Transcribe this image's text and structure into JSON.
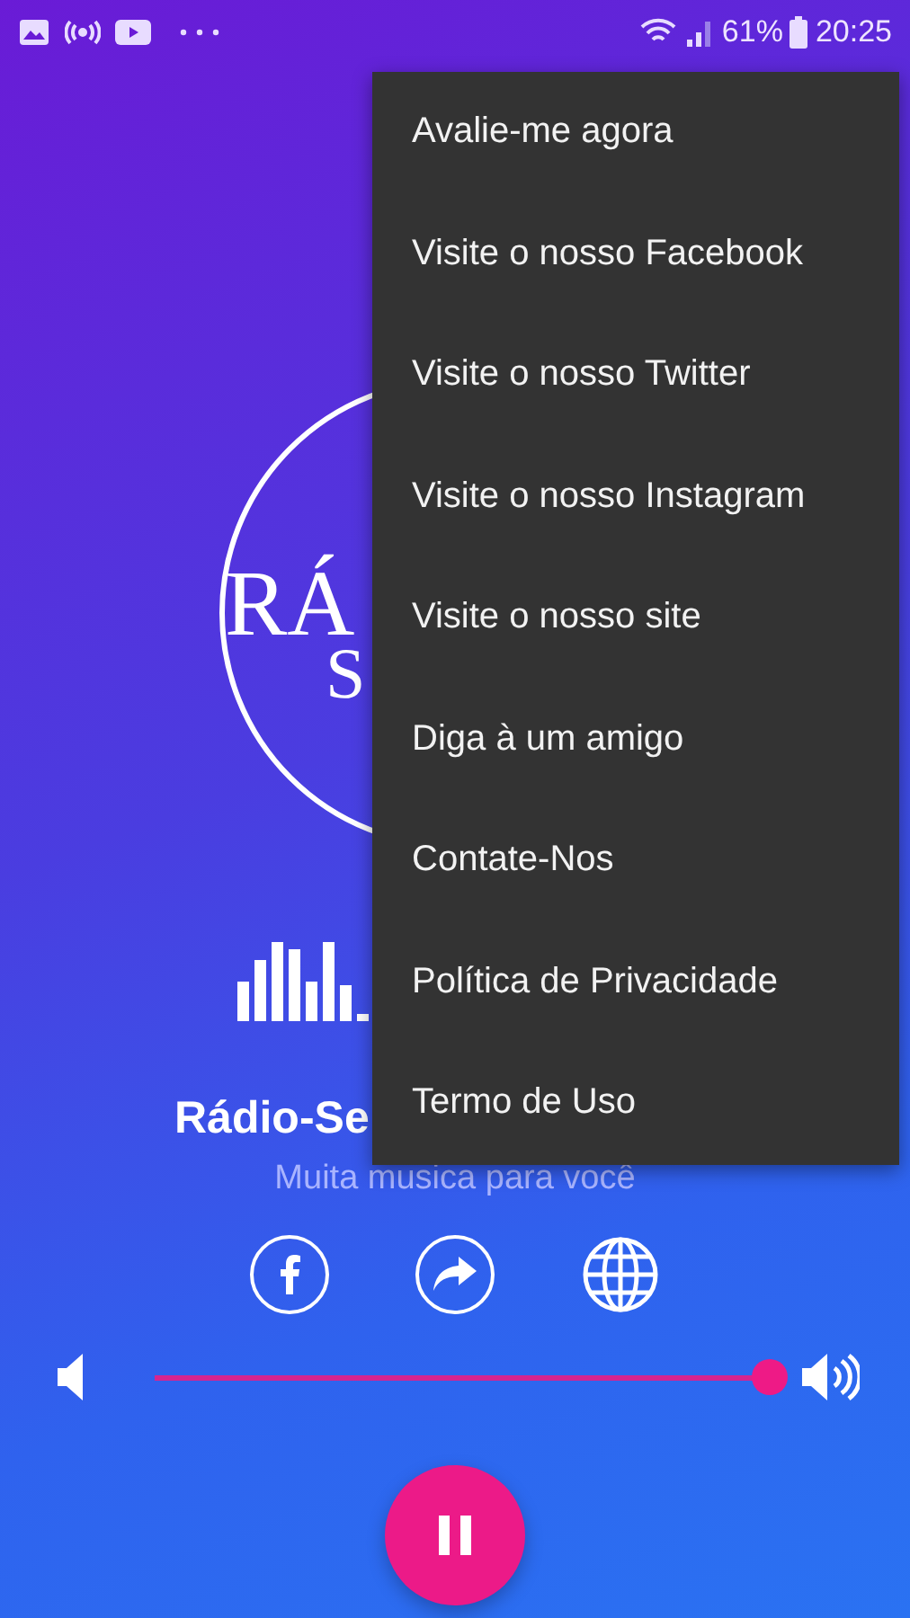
{
  "status_bar": {
    "battery": "61%",
    "time": "20:25"
  },
  "logo": {
    "text_top": "RÁ",
    "text_bottom": "S"
  },
  "station": {
    "name": "Rádio-Se",
    "slogan": "Muita musica para você"
  },
  "volume": {
    "level": 1.0
  },
  "player": {
    "playing": true
  },
  "menu": {
    "items": [
      {
        "label": "Avalie-me agora"
      },
      {
        "label": "Visite o nosso Facebook"
      },
      {
        "label": "Visite o nosso Twitter"
      },
      {
        "label": "Visite o nosso Instagram"
      },
      {
        "label": "Visite o nosso site"
      },
      {
        "label": "Diga à um amigo"
      },
      {
        "label": "Contate-Nos"
      },
      {
        "label": "Política de Privacidade"
      },
      {
        "label": "Termo de Uso"
      }
    ]
  }
}
